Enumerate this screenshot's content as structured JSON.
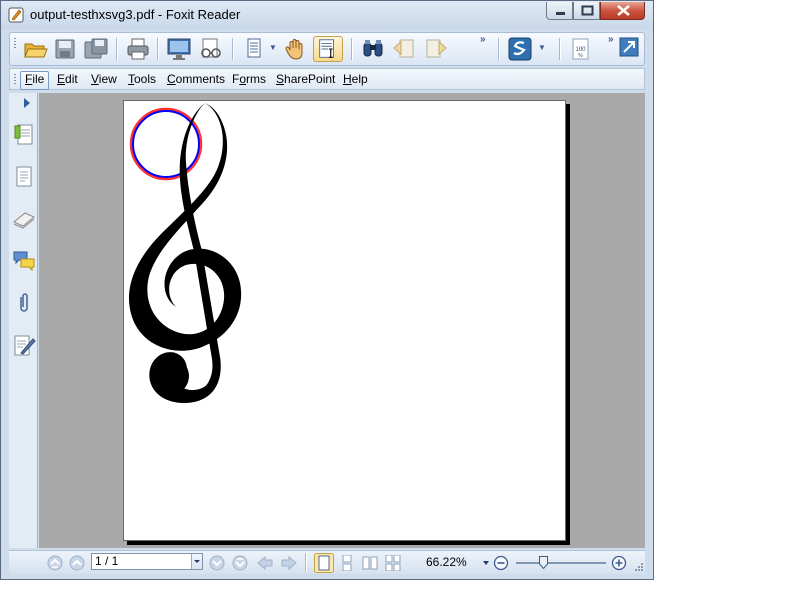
{
  "window": {
    "title": "output-testhxsvg3.pdf - Foxit Reader"
  },
  "toolbar": {
    "buttons": [
      "open-icon",
      "save-icon",
      "save-as-icon",
      "print-icon",
      "fullscreen-icon",
      "glasses-icon",
      "page-layout-icon",
      "hand-tool-icon",
      "select-text-icon",
      "find-icon",
      "previous-view-icon",
      "next-view-icon",
      "snapshot-icon",
      "actual-size-icon",
      "fit-page-icon"
    ],
    "overflow_symbol": "»",
    "active_tool": "select-text-icon"
  },
  "menu": {
    "items": [
      {
        "label": "File",
        "key": "F",
        "rest": "ile"
      },
      {
        "label": "Edit",
        "key": "E",
        "rest": "dit"
      },
      {
        "label": "View",
        "key": "V",
        "rest": "iew"
      },
      {
        "label": "Tools",
        "key": "T",
        "rest": "ools"
      },
      {
        "label": "Comments",
        "key": "C",
        "rest": "omments"
      },
      {
        "label": "Forms",
        "key": "o",
        "pre": "F",
        "rest": "rms"
      },
      {
        "label": "SharePoint",
        "key": "S",
        "rest": "harePoint"
      },
      {
        "label": "Help",
        "key": "H",
        "rest": "elp"
      }
    ],
    "selected": "File"
  },
  "sidebar": {
    "icons": [
      "bookmarks-icon",
      "pages-icon",
      "layers-icon",
      "comments-icon",
      "attachments-icon",
      "signatures-icon"
    ]
  },
  "document": {
    "content": "treble-clef-with-circle",
    "circle_colors": {
      "outer": "#ff3333",
      "inner": "#0000ff"
    }
  },
  "status": {
    "page_value": "1 / 1",
    "zoom": "66.22%",
    "zoom_slider_fraction": 0.3
  },
  "colors": {
    "window_frame": "#cfdcec",
    "doc_background": "#a9a9a9",
    "close_button": "#c8513d"
  }
}
